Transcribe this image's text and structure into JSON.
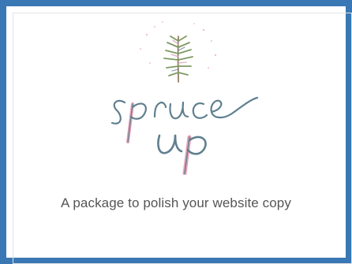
{
  "colors": {
    "frame": "#3a78b5",
    "background": "#ffffff",
    "tagline_text": "#555555",
    "script_slate": "#5f7f8f",
    "script_pink": "#e6a3b8",
    "sprig_green": "#7f9a63"
  },
  "logo": {
    "icon": "spruce-sprig-icon",
    "wordmark": "Spruce up"
  },
  "tagline": "A package to polish your website copy"
}
